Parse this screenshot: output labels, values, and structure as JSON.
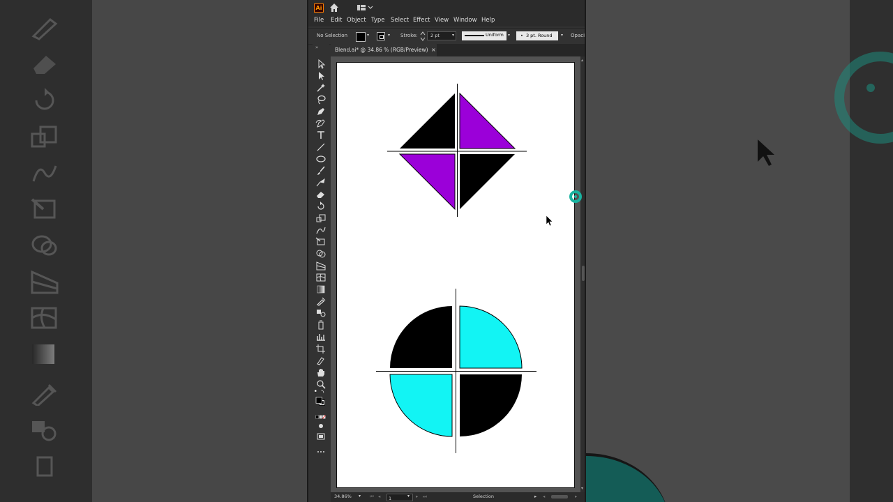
{
  "window": {
    "logo": "Ai"
  },
  "menu": [
    "File",
    "Edit",
    "Object",
    "Type",
    "Select",
    "Effect",
    "View",
    "Window",
    "Help"
  ],
  "control_bar": {
    "selection_state": "No Selection",
    "stroke_label": "Stroke:",
    "stroke_weight": "2 pt",
    "profile": "Uniform",
    "brush": "3 pt. Round",
    "opacity_label": "Opacity"
  },
  "document_tab": {
    "title": "Blend.ai* @ 34.86 % (RGB/Preview)",
    "close_glyph": "×"
  },
  "status_bar": {
    "zoom": "34.86%",
    "artboard": "1",
    "tool": "Selection"
  },
  "colors": {
    "purple": "#9b00d9",
    "cyan": "#12f4f4",
    "black": "#000000",
    "teal_cursor": "#19b3a0"
  },
  "tools": [
    "selection-tool",
    "direct-selection-tool",
    "magic-wand-tool",
    "lasso-tool",
    "pen-tool",
    "curvature-tool",
    "type-tool",
    "line-tool",
    "ellipse-tool",
    "paintbrush-tool",
    "shaper-tool",
    "eraser-tool",
    "rotate-tool",
    "scale-tool",
    "warp-tool",
    "free-transform-tool",
    "shape-builder-tool",
    "perspective-grid-tool",
    "mesh-tool",
    "gradient-tool",
    "eyedropper-tool",
    "blend-tool",
    "symbol-sprayer-tool",
    "graph-tool",
    "artboard-tool",
    "slice-tool",
    "hand-tool",
    "zoom-tool"
  ]
}
